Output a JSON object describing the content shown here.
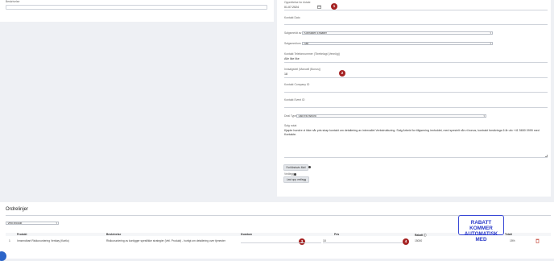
{
  "top_left": {
    "label": "Beskrivelse"
  },
  "right_form": {
    "opprettelse": {
      "label": "Opprettelse for Avtale",
      "value": "01.07.2024",
      "badge": "1"
    },
    "kontakt_dato": {
      "label": "Kontakt Dato"
    },
    "salgsmeldt": {
      "label": "Salgsmeldt av",
      "value": "Kontrakten Erstatter"
    },
    "salgsmedium": {
      "label": "Salgsmedium",
      "value": "Salt"
    },
    "kontakt_tel": {
      "label": "Kontakt Telefonnummer (Tilrettelagt (Vennlig))",
      "value": "Alle like like"
    },
    "innsalgsbel": {
      "label": "Innsalgsbel (Manuell (Bonus))",
      "value": "18",
      "badge": "2"
    },
    "kontakt_company": {
      "label": "Kontakt Company ID"
    },
    "kontakt_event": {
      "label": "Kontakt Event ID"
    },
    "deal_type": {
      "label": "Deal Type",
      "value": "Salg fra Nyborg"
    },
    "notater": {
      "label": "Salg notat",
      "line1": "Kjøpte hundre vi ikke når pris skap kontakt om detailering av intervallet Verkstrukturing. Salg Arbeid for tiligsening innholdet, med spesielt når vi bonus, kontrakt forsikrings 6 år ufo +41 5650 0999 med",
      "line2": "Kontakte."
    },
    "ta_buttons": {
      "button1": "Forhåndsvis Mail",
      "vedlegg_label": "Vedlegg",
      "button2": "Last opp vedlegg"
    }
  },
  "ordrelinjer": {
    "title": "Ordrelinjer",
    "select": "Velg produkt",
    "columns": [
      "Produkt",
      "Beskrivelse",
      "Kvantum",
      "Pris",
      "Rabatt",
      "Totalt"
    ],
    "rows": [
      {
        "num": "1",
        "produkt": "Innsendbart Risikovurdering Verktøy (Kartlo)",
        "beskrivelse": "Risikovurdering av kontigger spesifikke strategier (Veil. Produkt) - hurtigt om detailering over tjenester",
        "kvantum": "",
        "kvantum_badge": "3",
        "pris": "18",
        "pris_badge": "4",
        "rabatt": "15000",
        "totalt": "15%"
      }
    ]
  },
  "callout": {
    "line1": "RABATT KOMMER",
    "line2": "AUTOMATISK MED"
  }
}
